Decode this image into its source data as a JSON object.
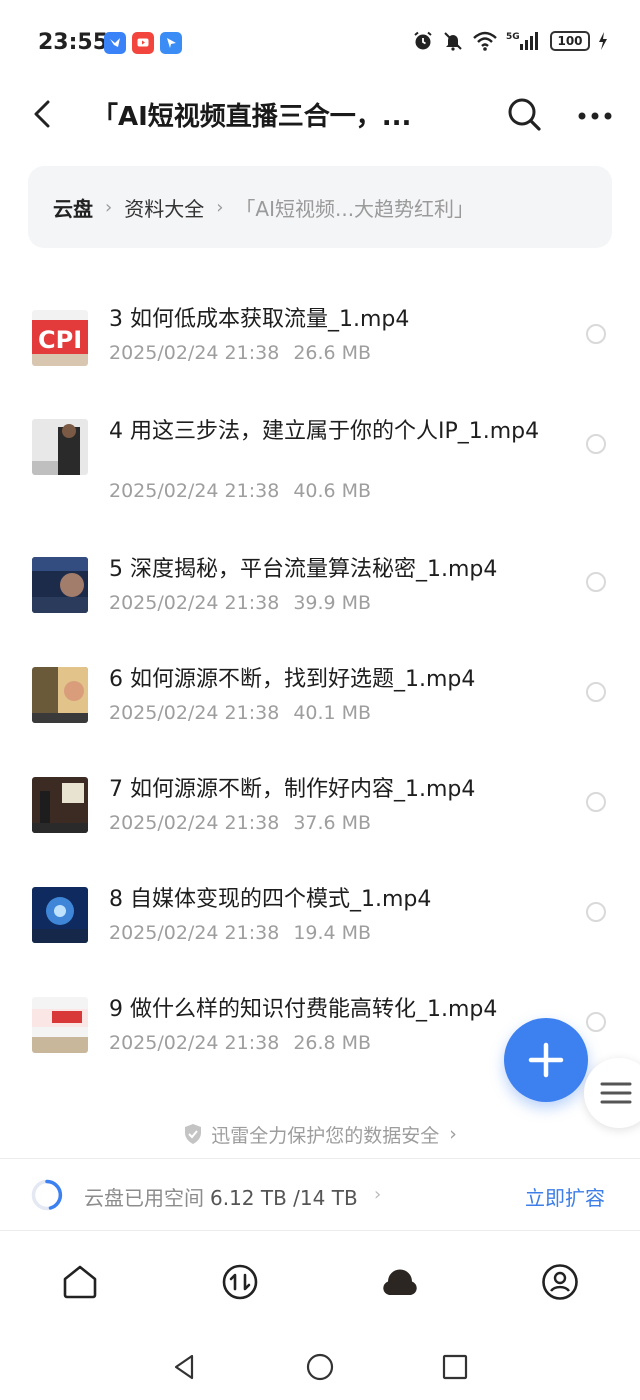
{
  "status_bar": {
    "time": "23:55",
    "battery": "100",
    "network": "5G",
    "colors": {
      "badge1": "#3a82f7",
      "badge2": "#f2453d",
      "badge3": "#3b8cf5"
    }
  },
  "header": {
    "title": "「AI短视频直播三合一，...",
    "back_icon": "chevron-left-icon",
    "search_icon": "search-icon",
    "more_icon": "more-icon"
  },
  "breadcrumb": {
    "root": "云盘",
    "middle": "资料大全",
    "current": "「AI短视频...大趋势红利」"
  },
  "files": [
    {
      "name": "3 如何低成本获取流量_1.mp4",
      "date": "2025/02/24 21:38",
      "size": "26.6 MB"
    },
    {
      "name": "4 用这三步法，建立属于你的个人IP_1.mp4",
      "date": "2025/02/24 21:38",
      "size": "40.6 MB"
    },
    {
      "name": "5 深度揭秘，平台流量算法秘密_1.mp4",
      "date": "2025/02/24 21:38",
      "size": "39.9 MB"
    },
    {
      "name": "6 如何源源不断，找到好选题_1.mp4",
      "date": "2025/02/24 21:38",
      "size": "40.1 MB"
    },
    {
      "name": "7 如何源源不断，制作好内容_1.mp4",
      "date": "2025/02/24 21:38",
      "size": "37.6 MB"
    },
    {
      "name": "8 自媒体变现的四个模式_1.mp4",
      "date": "2025/02/24 21:38",
      "size": "19.4 MB"
    },
    {
      "name": "9 做什么样的知识付费能高转化_1.mp4",
      "date": "2025/02/24 21:38",
      "size": "26.8 MB"
    }
  ],
  "security_notice": "迅雷全力保护您的数据安全",
  "storage": {
    "label": "云盘已用空间",
    "used": "6.12 TB /14 TB",
    "action": "立即扩容"
  },
  "accent_color": "#3d80f0"
}
